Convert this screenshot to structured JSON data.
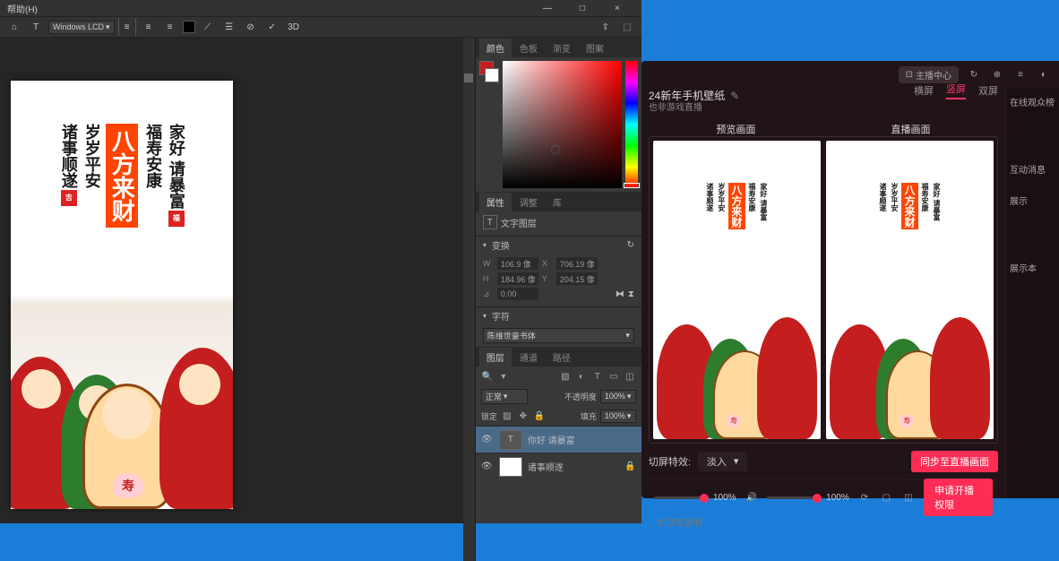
{
  "ps": {
    "menu": {
      "help": "帮助(H)"
    },
    "window": {
      "min": "—",
      "max": "□",
      "close": "×"
    },
    "toolbar": {
      "text_tool": "T",
      "dropdown": "Windows LCD",
      "3d": "3D"
    },
    "color_panel": {
      "tabs": [
        "颜色",
        "色板",
        "渐变",
        "图案"
      ],
      "selected_hex": "#8b2222"
    },
    "properties": {
      "tabs": [
        "属性",
        "调整",
        "库"
      ],
      "type_label": "文字图层",
      "transform": {
        "header": "变换",
        "w": "106.9 像",
        "w_val": "706.19 像",
        "h": "184.96 像",
        "y_val": "204.15 像",
        "angle": "0.00"
      },
      "character": {
        "header": "字符",
        "font": "陈维世豪书体"
      }
    },
    "layers": {
      "tabs": [
        "图层",
        "通道",
        "路径"
      ],
      "search_placeholder": "",
      "blend_mode": "正常",
      "opacity_label": "不透明度",
      "opacity": "100%",
      "fill_label": "填充",
      "fill": "100%",
      "lock_label": "锁定",
      "items": [
        {
          "name": "你好 请暴富",
          "thumb": "T",
          "visible": true
        },
        {
          "name": "诸事顺遂",
          "thumb": "img",
          "visible": true
        }
      ]
    }
  },
  "artwork": {
    "cols": [
      "诸事顺遂",
      "岁岁平安",
      "八方来财",
      "福寿安康",
      "家好 请暴富"
    ]
  },
  "stream": {
    "title": "24新年手机壁纸",
    "subtitle": "也非游戏直播",
    "host_center": "主播中心",
    "display_tabs": [
      "横屏",
      "竖屏",
      "双屏"
    ],
    "preview_labels": [
      "预览画面",
      "直播画面"
    ],
    "effect_label": "切屏特效:",
    "effect_value": "淡入",
    "sync_btn": "同步至直播画面",
    "zoom1": "100%",
    "zoom2": "100%",
    "start_btn": "申请开播权限",
    "side": {
      "audience": "在线观众榜",
      "interact": "互动消息",
      "show1": "展示",
      "show2": "展示本"
    },
    "footer": "的游戏说明"
  }
}
